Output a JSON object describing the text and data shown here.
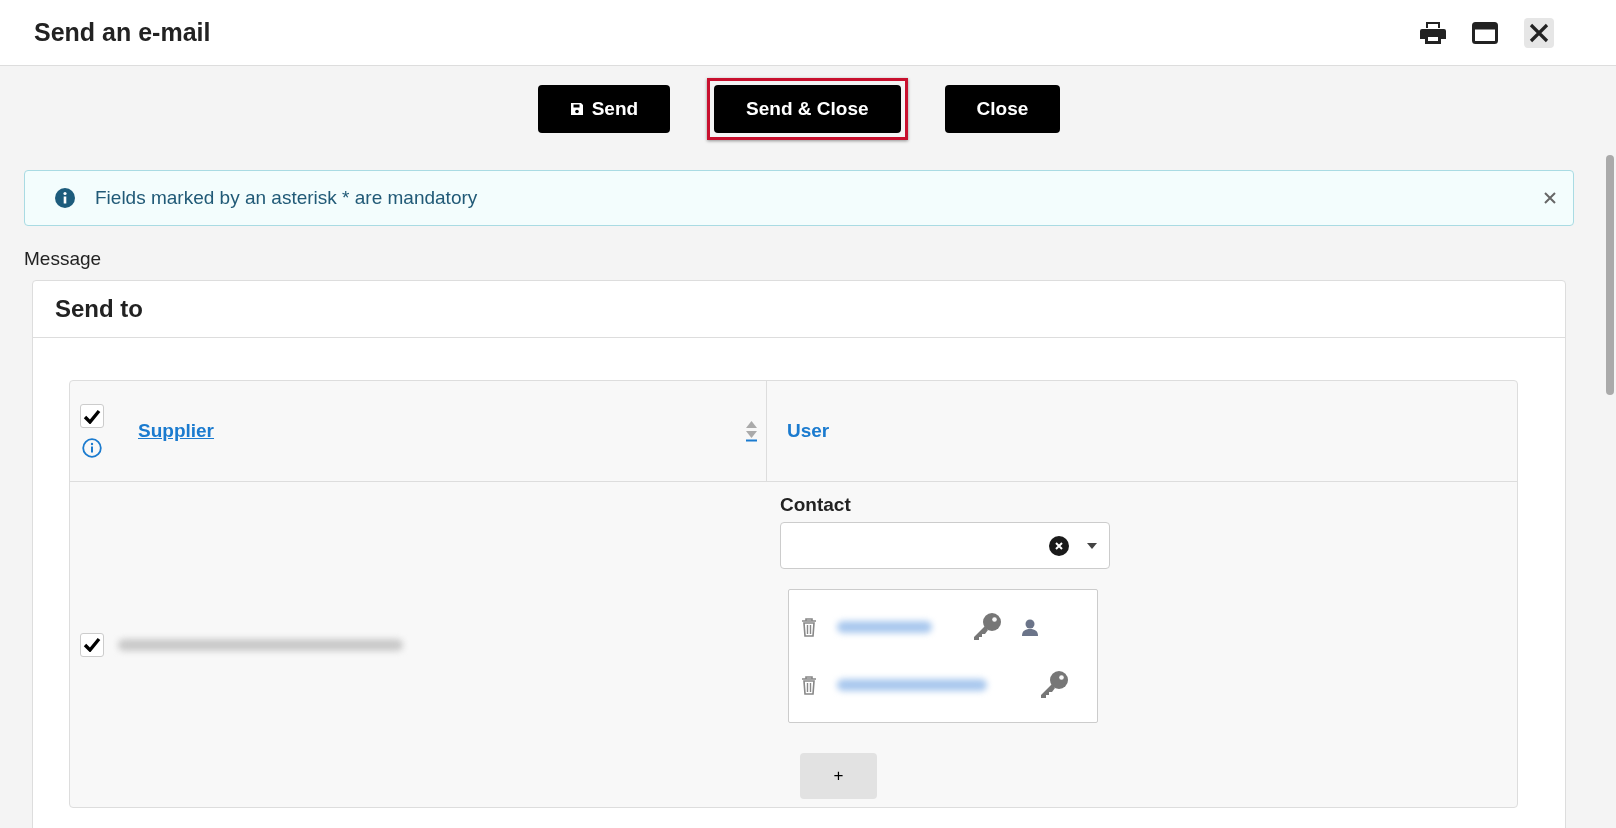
{
  "window": {
    "title": "Send an e-mail"
  },
  "toolbar": [
    {
      "label": "Send",
      "kind": "save",
      "highlighted": false
    },
    {
      "label": "Send & Close",
      "kind": "plain",
      "highlighted": true
    },
    {
      "label": "Close",
      "kind": "plain",
      "highlighted": false
    }
  ],
  "info_banner": {
    "text": "Fields marked by an asterisk * are mandatory"
  },
  "section_label": "Message",
  "card": {
    "title": "Send to",
    "table": {
      "all_checked": true,
      "columns": [
        {
          "label": "Supplier",
          "sortable": true,
          "underlined": true
        },
        {
          "label": "User",
          "sortable": false,
          "underlined": false
        }
      ],
      "rows": [
        {
          "checked": true,
          "contact_label": "Contact",
          "contacts": [
            {
              "has_user": true
            },
            {
              "has_user": false
            }
          ],
          "add_label": "+"
        }
      ]
    }
  }
}
